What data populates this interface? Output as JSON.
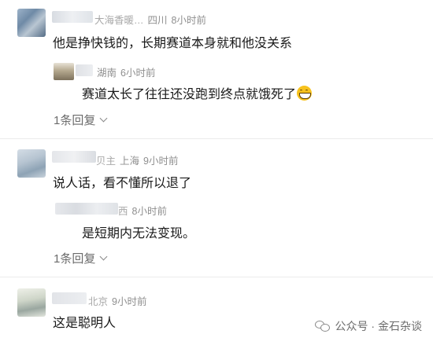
{
  "comments": [
    {
      "name_visible": "大海香暖…",
      "location": "四川",
      "time": "8小时前",
      "text": "他是挣快钱的，长期赛道本身就和他没关系",
      "reply": {
        "location": "湖南",
        "time": "6小时前",
        "text": "赛道太长了往往还没跑到终点就饿死了"
      },
      "more_label": "1条回复"
    },
    {
      "name_visible": "贝主",
      "location": "上海",
      "time": "9小时前",
      "text": "说人话，看不懂所以退了",
      "reply": {
        "name_visible": "西",
        "time": "8小时前",
        "text": "是短期内无法变现。"
      },
      "more_label": "1条回复"
    },
    {
      "name_visible": "北京",
      "time": "9小时前",
      "text": "这是聪明人"
    }
  ],
  "watermark": {
    "text": "公众号 · 金石杂谈",
    "icon": "wechat-icon"
  },
  "colors": {
    "meta": "#8f8f8f",
    "text": "#1a1a1a",
    "divider": "#ececec"
  }
}
